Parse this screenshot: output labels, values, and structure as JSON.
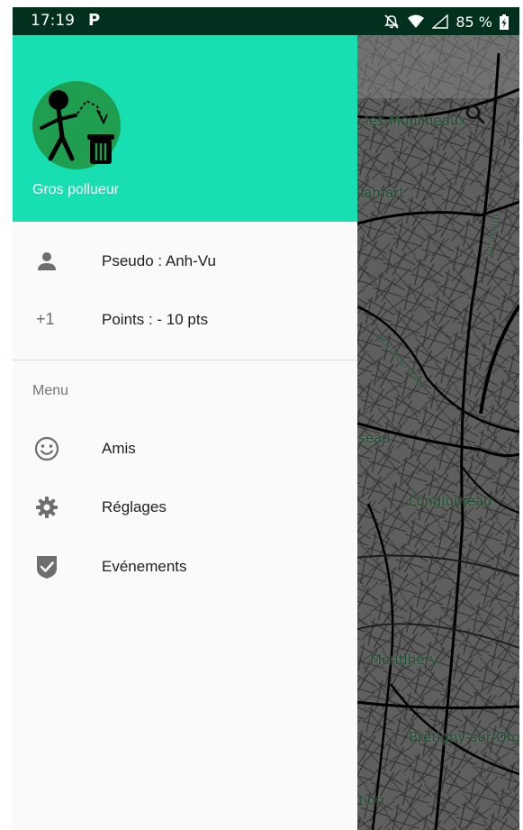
{
  "status_bar": {
    "time": "17:19",
    "notification_glyph": "P",
    "battery_percent": "85 %",
    "icons": [
      "parking-notification-icon",
      "alarm-off-icon",
      "wifi-icon",
      "cellular-signal-icon",
      "battery-charging-icon"
    ]
  },
  "drawer": {
    "header": {
      "background_color": "#18dfb2",
      "avatar_icon": "litterer-avatar-icon",
      "title": "Gros pollueur"
    },
    "profile_items": [
      {
        "icon": "person-icon",
        "label": "Pseudo : Anh-Vu"
      },
      {
        "icon_text": "+1",
        "label": "Points : - 10 pts"
      }
    ],
    "menu_header": "Menu",
    "menu_items": [
      {
        "icon": "smiley-icon",
        "label": "Amis"
      },
      {
        "icon": "gear-icon",
        "label": "Réglages"
      },
      {
        "icon": "shield-check-icon",
        "label": "Evénements"
      }
    ]
  },
  "map": {
    "search_icon": "search-icon",
    "labels": {
      "moulineaux": "-les-Moulineaux",
      "clamart": "lamart",
      "hauts_de_seine": "HAUTS-DE-SEINE",
      "road": "AUTOROUTE",
      "palaiseau": "seau",
      "longjumeau": "Longjumeau",
      "montlhery": "Montlhéry",
      "bretigny": "Brétigny-sur-Orge",
      "bottom": "tion"
    }
  },
  "colors": {
    "status_bar": "#02301f",
    "header": "#18dfb2",
    "drawer_bg": "#fafafa",
    "icon_gray": "#6e6e6e",
    "map_overlay": "#5f5f5f"
  }
}
